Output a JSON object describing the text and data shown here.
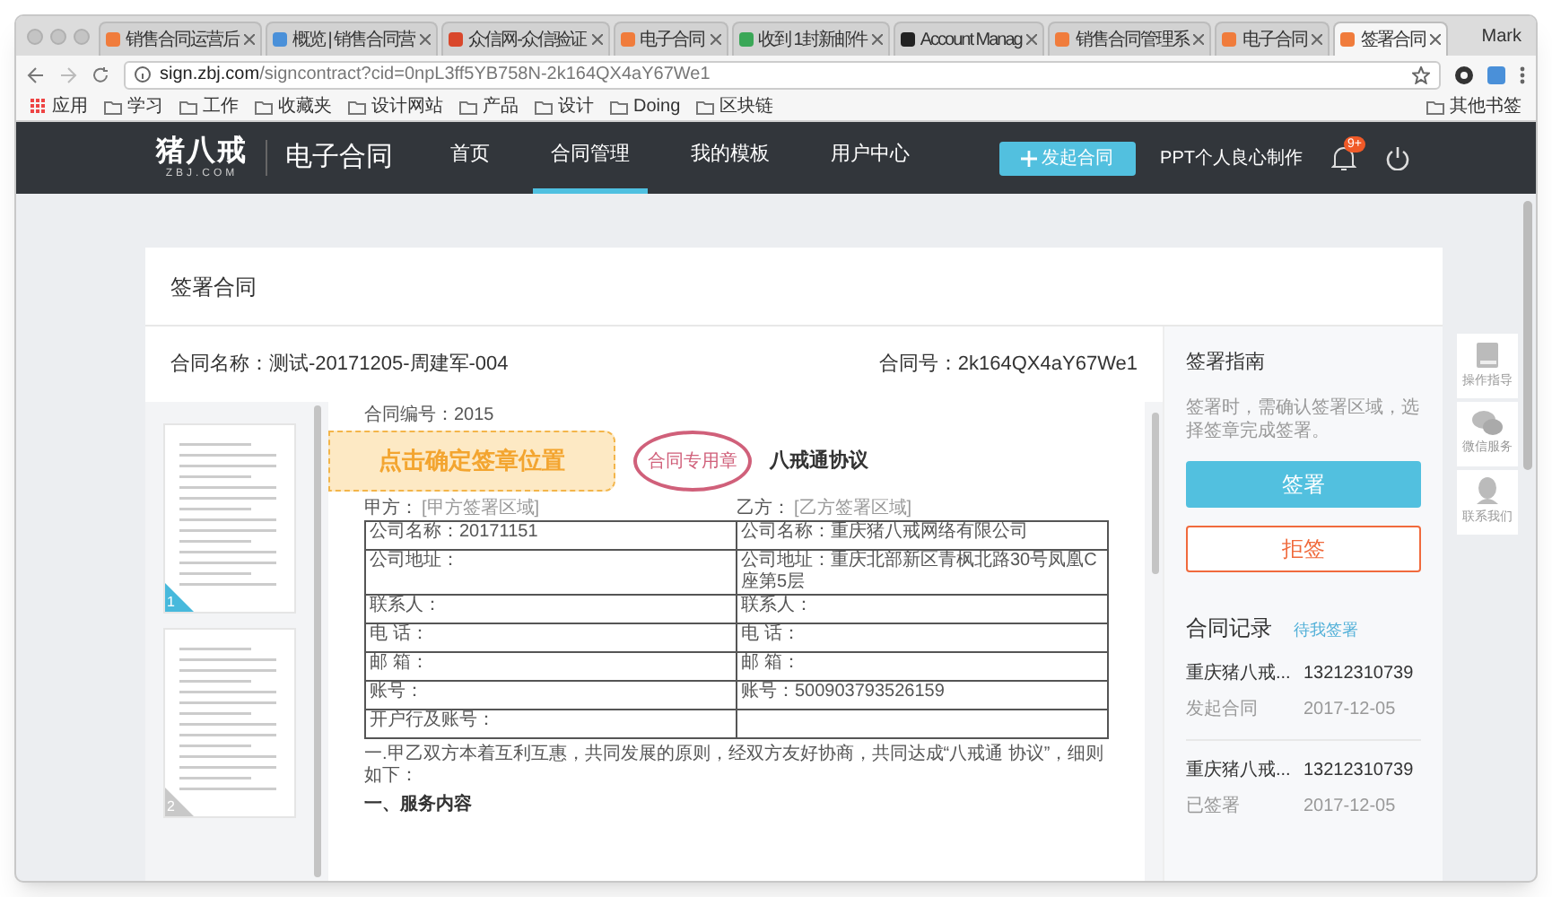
{
  "browser": {
    "tabs": [
      {
        "title": "销售合同运营后",
        "color": "#f07c3c",
        "selected": false
      },
      {
        "title": "概览 | 销售合同营",
        "color": "#4a90d9",
        "selected": false
      },
      {
        "title": "众信网-众信验证",
        "color": "#d9472b",
        "selected": false
      },
      {
        "title": "电子合同",
        "color": "#f07c3c",
        "selected": false
      },
      {
        "title": "收到 1封新邮件",
        "color": "#3aa757",
        "selected": false
      },
      {
        "title": "Account Manag",
        "color": "#222222",
        "selected": false
      },
      {
        "title": "销售合同管理系",
        "color": "#f07c3c",
        "selected": false
      },
      {
        "title": "电子合同",
        "color": "#f07c3c",
        "selected": false
      },
      {
        "title": "签署合同",
        "color": "#f07c3c",
        "selected": true
      }
    ],
    "profile": "Mark",
    "address": {
      "host": "sign.zbj.com",
      "path": "/signcontract?cid=0npL3ff5YB758N-2k164QX4aY67We1"
    },
    "bookmarks": [
      "应用",
      "学习",
      "工作",
      "收藏夹",
      "设计网站",
      "产品",
      "设计",
      "Doing",
      "区块链"
    ],
    "other_bookmarks": "其他书签"
  },
  "nav": {
    "logo": "猪八戒",
    "logo_sub": "ZBJ.COM",
    "product": "电子合同",
    "items": [
      {
        "label": "首页",
        "selected": false
      },
      {
        "label": "合同管理",
        "selected": true
      },
      {
        "label": "我的模板",
        "selected": false
      },
      {
        "label": "用户中心",
        "selected": false
      }
    ],
    "new_button": "发起合同",
    "user": "PPT个人良心制作",
    "badge": "9+"
  },
  "page": {
    "title": "签署合同",
    "contract_name": "合同名称：测试-20171205-周建军-004",
    "contract_no": "合同号：2k164QX4aY67We1",
    "thumbnails": [
      {
        "label": "1",
        "selected": true
      },
      {
        "label": "2",
        "selected": false
      }
    ],
    "document": {
      "number": "合同编号：2015",
      "title": "八戒通协议",
      "party_a": "甲方：",
      "party_a_area": "[甲方签署区域]",
      "party_b": "乙方：",
      "party_b_area": "[乙方签署区域]",
      "stamp": "合同专用章",
      "rows": [
        [
          "公司名称：20171151",
          "公司名称：重庆猪八戒网络有限公司"
        ],
        [
          "公司地址：",
          "公司地址：重庆北部新区青枫北路30号凤凰C座第5层"
        ],
        [
          "联系人：",
          "联系人："
        ],
        [
          "电 话：",
          "电 话："
        ],
        [
          "邮 箱：",
          "邮 箱："
        ],
        [
          "账号：",
          "账号：500903793526159"
        ],
        [
          "开户行及账号：",
          ""
        ]
      ],
      "paragraph": "一.甲乙双方本着互利互惠，共同发展的原则，经双方友好协商，共同达成“八戒通 协议”，细则如下：",
      "section": "一、服务内容"
    },
    "overlay": "点击确定签章位置",
    "guide": {
      "title": "签署指南",
      "text": "签署时，需确认签署区域，选择签章完成签署。",
      "sign": "签署",
      "reject": "拒签"
    },
    "records": {
      "title": "合同记录",
      "link": "待我签署",
      "items": [
        {
          "name": "重庆猪八戒...",
          "phone": "13212310739",
          "action": "发起合同",
          "date": "2017-12-05"
        },
        {
          "name": "重庆猪八戒...",
          "phone": "13212310739",
          "action": "已签署",
          "date": "2017-12-05"
        }
      ]
    },
    "side": [
      {
        "kind": "book",
        "label": "操作指导"
      },
      {
        "kind": "chat",
        "label": "微信服务"
      },
      {
        "kind": "person",
        "label": "联系我们"
      }
    ]
  }
}
